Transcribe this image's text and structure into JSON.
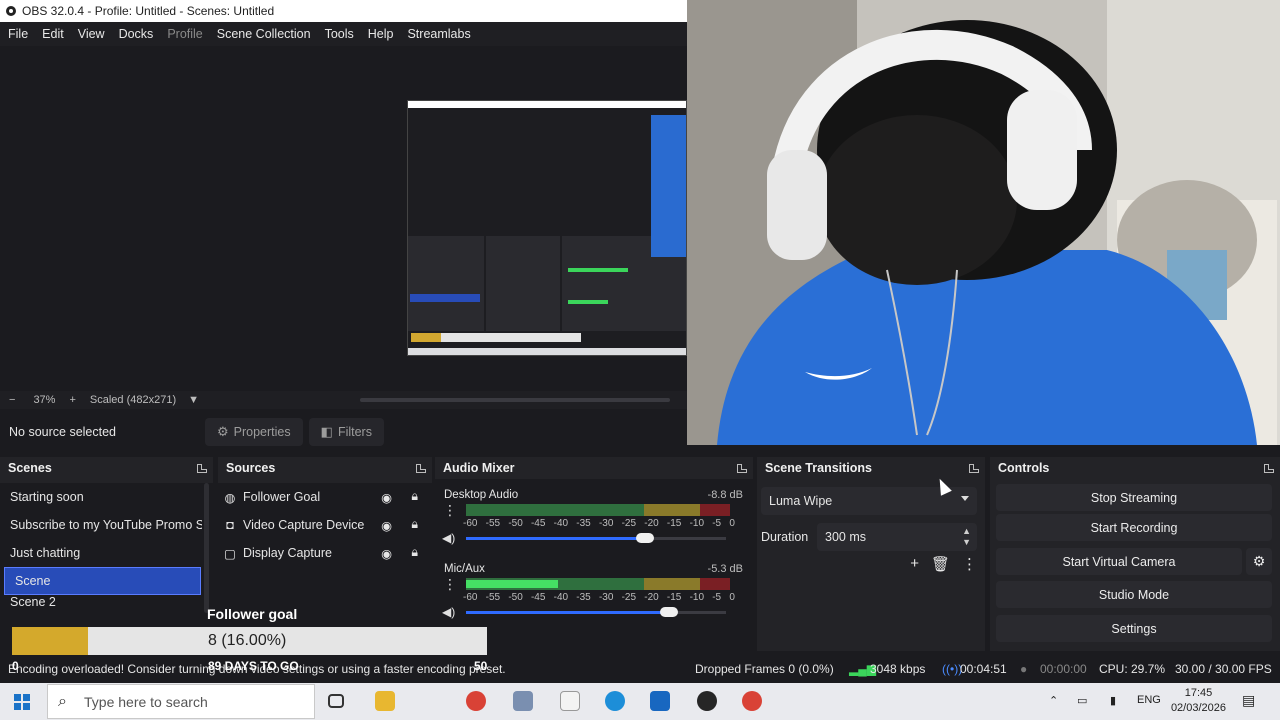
{
  "window": {
    "title": "OBS 32.0.4 - Profile: Untitled - Scenes: Untitled"
  },
  "menu": [
    {
      "label": "File"
    },
    {
      "label": "Edit"
    },
    {
      "label": "View"
    },
    {
      "label": "Docks"
    },
    {
      "label": "Profile",
      "disabled": true
    },
    {
      "label": "Scene Collection"
    },
    {
      "label": "Tools"
    },
    {
      "label": "Help"
    },
    {
      "label": "Streamlabs"
    }
  ],
  "zoom": {
    "minus": "−",
    "value": "37%",
    "plus": "+",
    "scale": "Scaled (482x271)"
  },
  "source_toolbar": {
    "no_source": "No source selected",
    "properties": "Properties",
    "filters": "Filters"
  },
  "docks": {
    "scenes": {
      "title": "Scenes",
      "items": [
        "Starting soon",
        "Subscribe to my YouTube Promo S",
        "Just chatting",
        "Scene",
        "Scene 2"
      ],
      "selected_index": 3
    },
    "sources": {
      "title": "Sources",
      "items": [
        {
          "label": "Follower Goal",
          "icon": "globe-icon"
        },
        {
          "label": "Video Capture Device",
          "icon": "camera-icon"
        },
        {
          "label": "Display Capture",
          "icon": "monitor-icon"
        }
      ]
    },
    "mixer": {
      "title": "Audio Mixer",
      "channels": [
        {
          "name": "Desktop Audio",
          "db": "-8.8 dB",
          "level": 0.0,
          "volume": 0.69
        },
        {
          "name": "Mic/Aux",
          "db": "-5.3 dB",
          "level": 0.35,
          "volume": 0.78
        }
      ],
      "ticks": [
        "-60",
        "-55",
        "-50",
        "-45",
        "-40",
        "-35",
        "-30",
        "-25",
        "-20",
        "-15",
        "-10",
        "-5",
        "0"
      ]
    },
    "transitions": {
      "title": "Scene Transitions",
      "selected": "Luma Wipe",
      "duration_label": "Duration",
      "duration_value": "300 ms"
    },
    "controls": {
      "title": "Controls",
      "buttons": [
        "Stop Streaming",
        "Start Recording",
        "Start Virtual Camera",
        "Studio Mode",
        "Settings"
      ]
    }
  },
  "goal": {
    "title": "Follower goal",
    "progress_text": "8 (16.00%)",
    "fraction": 0.16,
    "left": "0",
    "days": "89 DAYS TO GO",
    "target": "50"
  },
  "status": {
    "warning": "Encoding overloaded! Consider turning down video settings or using a faster encoding preset.",
    "dropped": "Dropped Frames 0 (0.0%)",
    "bitrate": "3048 kbps",
    "stream_time": "00:04:51",
    "rec_time": "00:00:00",
    "cpu": "CPU: 29.7%",
    "fps": "30.00 / 30.00 FPS"
  },
  "taskbar": {
    "search_placeholder": "Type here to search",
    "lang": "ENG",
    "time": "17:45",
    "date": "02/03/2026"
  },
  "colors": {
    "accent": "#284cb8",
    "meter_green": "#45e064",
    "goal_fill": "#d4a92c"
  }
}
